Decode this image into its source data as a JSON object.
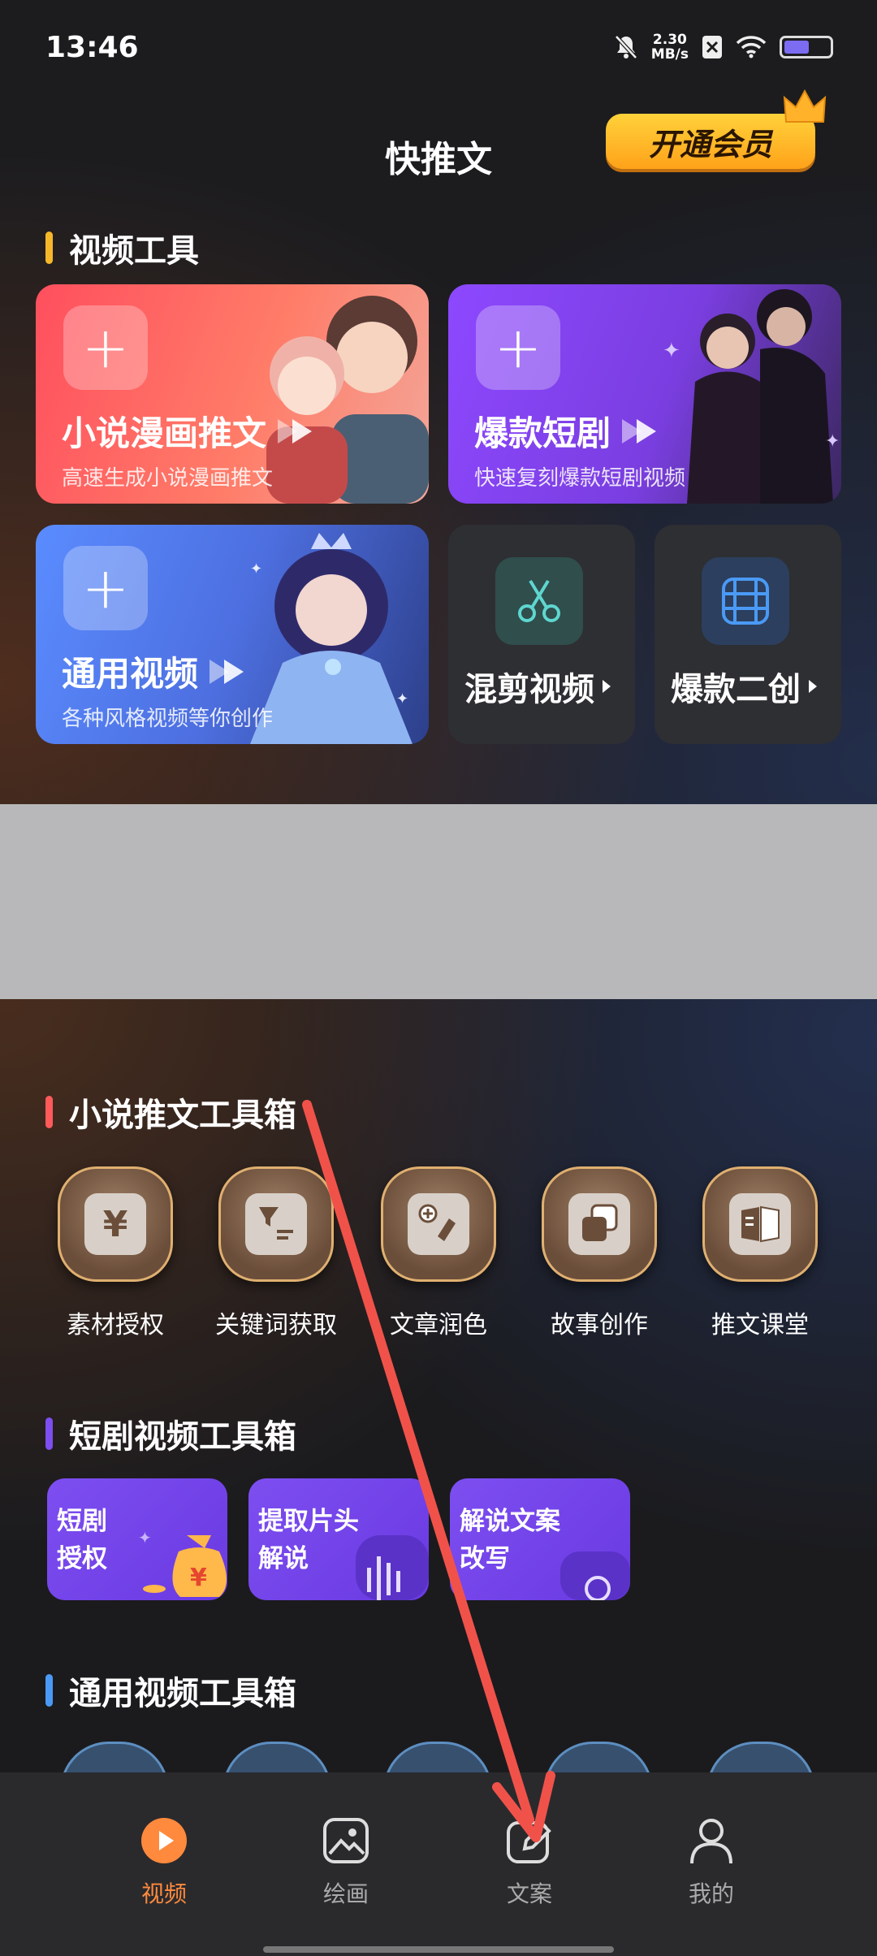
{
  "status": {
    "time": "13:46",
    "net_speed_value": "2.30",
    "net_speed_unit": "MB/s"
  },
  "header": {
    "title": "快推文",
    "vip_label": "开通会员"
  },
  "sections": {
    "video_tools": "视频工具",
    "novel_toolbox": "小说推文工具箱",
    "drama_toolbox": "短剧视频工具箱",
    "general_toolbox": "通用视频工具箱"
  },
  "video_cards": [
    {
      "title": "小说漫画推文",
      "subtitle": "高速生成小说漫画推文"
    },
    {
      "title": "爆款短剧",
      "subtitle": "快速复刻爆款短剧视频"
    },
    {
      "title": "通用视频",
      "subtitle": "各种风格视频等你创作"
    }
  ],
  "small_cards": [
    {
      "title": "混剪视频"
    },
    {
      "title": "爆款二创"
    }
  ],
  "novel_tools": [
    {
      "label": "素材授权",
      "icon": "yen-document-icon"
    },
    {
      "label": "关键词获取",
      "icon": "filter-list-icon"
    },
    {
      "label": "文章润色",
      "icon": "polish-edit-icon"
    },
    {
      "label": "故事创作",
      "icon": "story-cards-icon"
    },
    {
      "label": "推文课堂",
      "icon": "open-book-icon"
    }
  ],
  "drama_tools": [
    {
      "label": "短剧\n授权"
    },
    {
      "label": "提取片头\n解说"
    },
    {
      "label": "解说文案\n改写"
    }
  ],
  "bottom_nav": [
    {
      "label": "视频",
      "active": true
    },
    {
      "label": "绘画",
      "active": false
    },
    {
      "label": "文案",
      "active": false
    },
    {
      "label": "我的",
      "active": false
    }
  ],
  "colors": {
    "accent": "#ff8a3d",
    "vip_gold": "#ffb22a",
    "drama_purple": "#7d4ef0"
  }
}
